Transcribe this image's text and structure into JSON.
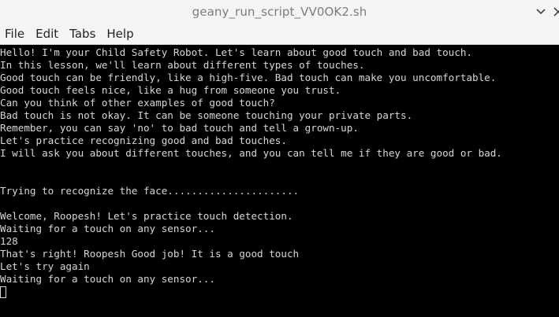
{
  "window": {
    "title": "geany_run_script_VV0OK2.sh"
  },
  "menubar": {
    "items": [
      "File",
      "Edit",
      "Tabs",
      "Help"
    ]
  },
  "terminal": {
    "lines": [
      "Hello! I'm your Child Safety Robot. Let's learn about good touch and bad touch.",
      "In this lesson, we'll learn about different types of touches.",
      "Good touch can be friendly, like a high-five. Bad touch can make you uncomfortable.",
      "Good touch feels nice, like a hug from someone you trust.",
      "Can you think of other examples of good touch?",
      "Bad touch is not okay. It can be someone touching your private parts.",
      "Remember, you can say 'no' to bad touch and tell a grown-up.",
      "Let's practice recognizing good and bad touches.",
      "I will ask you about different touches, and you can tell me if they are good or bad.",
      "",
      "",
      "Trying to recognize the face......................",
      "",
      "Welcome, Roopesh! Let's practice touch detection.",
      "Waiting for a touch on any sensor...",
      "128",
      "That's right! Roopesh Good job! It is a good touch",
      "Let's try again",
      "Waiting for a touch on any sensor..."
    ]
  },
  "icons": {
    "chevron": "chevron-down-icon",
    "close": "close-icon"
  },
  "colors": {
    "terminal_bg": "#000000",
    "terminal_fg": "#d6d6d6",
    "chrome_bg": "#f4f4f4"
  }
}
